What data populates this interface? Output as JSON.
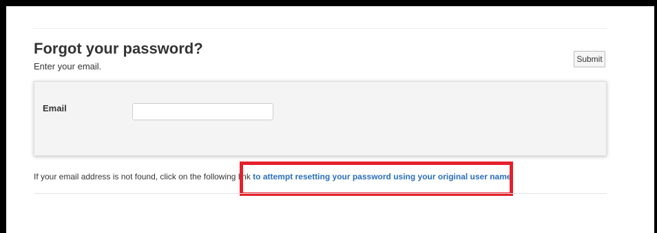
{
  "header": {
    "title": "Forgot your password?",
    "subtitle": "Enter your email."
  },
  "toolbar": {
    "submit_label": "Submit"
  },
  "form": {
    "email_label": "Email",
    "email_value": "",
    "email_placeholder": ""
  },
  "notice": {
    "text_before": "If your email address is not found, click on the following link",
    "link_text": "to attempt resetting your password using your original user name",
    "text_after": "."
  },
  "colors": {
    "link": "#2a6ebb",
    "highlight": "#e5202b",
    "panel_background": "#f4f4f4"
  }
}
